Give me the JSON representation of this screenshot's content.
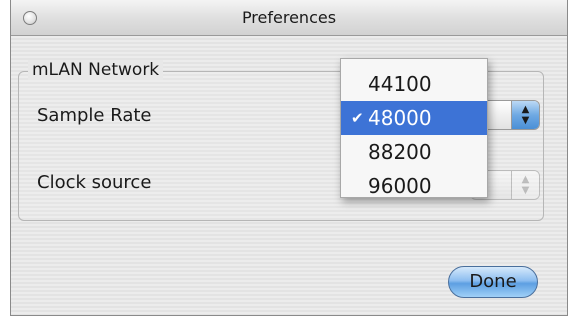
{
  "window": {
    "title": "Preferences"
  },
  "group": {
    "title": "mLAN Network"
  },
  "fields": {
    "sample_rate_label": "Sample Rate",
    "clock_source_label": "Clock source"
  },
  "sample_rate_popup": {
    "options": [
      {
        "label": "44100",
        "selected": false
      },
      {
        "label": "48000",
        "selected": true
      },
      {
        "label": "88200",
        "selected": false
      },
      {
        "label": "96000",
        "selected": false
      }
    ]
  },
  "clock_source_popup": {
    "partial_value": ")"
  },
  "buttons": {
    "done": "Done"
  },
  "colors": {
    "selection_highlight": "#3d73d6",
    "aqua_button": "#5d9fe2"
  },
  "icons": {
    "check": "checkmark-icon",
    "popup_arrows": "up-down-arrows-icon",
    "close": "close-circle-icon"
  }
}
